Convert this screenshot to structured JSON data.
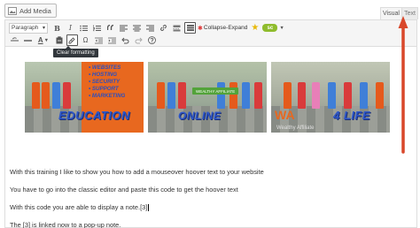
{
  "header": {
    "add_media_label": "Add Media",
    "tab_visual": "Visual",
    "tab_text": "Text"
  },
  "toolbar": {
    "paragraph_select": "Paragraph",
    "row1_icons": [
      "bold-icon",
      "italic-icon",
      "bulleted-list-icon",
      "numbered-list-icon",
      "blockquote-icon",
      "align-left-icon",
      "align-center-icon",
      "align-right-icon",
      "insert-link-icon",
      "remove-link-icon",
      "read-more-icon",
      "toolbar-toggle-icon"
    ],
    "bold_glyph": "B",
    "italic_glyph": "I",
    "collapse_expand_label": "Collapse-Expand",
    "shortcode_badge": "sc",
    "row2_icons": [
      "strikethrough-icon",
      "horizontal-line-icon",
      "text-color-icon",
      "paste-as-text-icon",
      "clear-formatting-icon",
      "special-character-icon",
      "decrease-indent-icon",
      "increase-indent-icon",
      "undo-icon",
      "redo-icon",
      "help-icon"
    ],
    "text_color_glyph": "A",
    "omega_glyph": "Ω",
    "tooltip": "Clear formatting"
  },
  "content": {
    "banner1": {
      "bullets": [
        "WEBSITES",
        "HOSTING",
        "SECURITY",
        "SUPPORT",
        "MARKETING"
      ],
      "word": "EDUCATION"
    },
    "banner2": {
      "ribbon": "WEALTHY AFFILIATE",
      "word": "ONLINE"
    },
    "banner3": {
      "logo": "WA",
      "sub": "Wealthy Affiliate",
      "word": "4 LIFE"
    },
    "paragraphs": [
      "With this training I like to show you how to add a mouseover hoover text to your website",
      "You have to go into the classic editor and paste this code to get the hoover text",
      "With this code you are able to display a note.[3]",
      "The [3] is linked now to a pop-up note."
    ]
  },
  "colors": {
    "annotation_arrow": "#d9482b",
    "banner_text": "#2d56c9",
    "banner_orange": "#e8681f",
    "toolbar_bg": "#f5f5f5"
  }
}
